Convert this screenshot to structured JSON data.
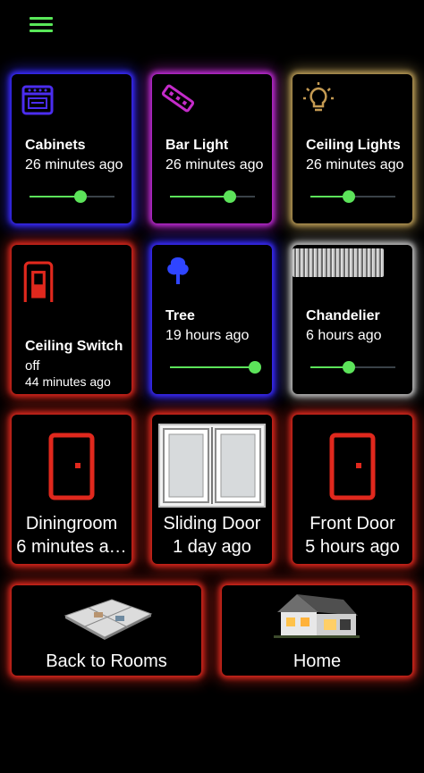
{
  "lights": [
    {
      "title": "Cabinets",
      "time": "26 minutes ago",
      "level": 0.6
    },
    {
      "title": "Bar Light",
      "time": "26 minutes ago",
      "level": 0.7
    },
    {
      "title": "Ceiling Lights",
      "time": "26 minutes ago",
      "level": 0.45
    },
    {
      "title": "Tree",
      "time": "19 hours ago",
      "level": 1.0
    },
    {
      "title": "Chandelier",
      "time": "6 hours ago",
      "level": 0.45
    }
  ],
  "switch": {
    "title": "Ceiling Switch",
    "state": "off",
    "time": "44 minutes ago"
  },
  "doors": [
    {
      "title": "Diningroom",
      "time": "6 minutes a…"
    },
    {
      "title": "Sliding Door",
      "time": "1 day ago"
    },
    {
      "title": "Front Door",
      "time": "5 hours ago"
    }
  ],
  "nav": {
    "back": "Back to Rooms",
    "home": "Home"
  },
  "colors": {
    "accent": "#5ce35a",
    "red": "#d8271d",
    "blue": "#3b2cff",
    "purple": "#c02cd6",
    "gold": "#b89a56"
  },
  "icons": {
    "menu": "hamburger-menu-icon",
    "cabinets": "stove-icon",
    "bar": "led-strip-icon",
    "ceiling": "lightbulb-icon",
    "switch": "light-switch-icon",
    "tree": "tree-icon",
    "door": "door-icon"
  }
}
